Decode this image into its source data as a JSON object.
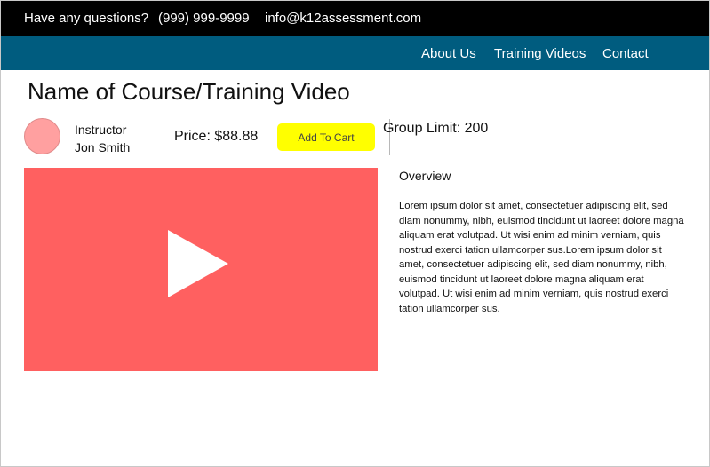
{
  "topbar": {
    "question": "Have any questions?",
    "phone": "(999) 999-9999",
    "email": "info@k12assessment.com"
  },
  "nav": {
    "items": [
      "About Us",
      "Training Videos",
      "Contact"
    ]
  },
  "course": {
    "title": "Name of Course/Training Video",
    "instructor_label": "Instructor",
    "instructor_name": "Jon Smith",
    "price": "Price: $88.88",
    "add_to_cart": "Add To Cart",
    "group_limit": "Group Limit: 200"
  },
  "overview": {
    "title": "Overview",
    "text": "Lorem ipsum dolor sit amet, consectetuer adipiscing elit, sed diam nonummy, nibh, euismod tincidunt ut laoreet dolore magna aliquam erat volutpad. Ut wisi enim ad minim verniam, quis nostrud exerci tation ullamcorper sus.Lorem ipsum dolor sit amet, consectetuer adipiscing elit, sed diam nonummy, nibh, euismod tincidunt ut laoreet dolore magna aliquam erat volutpad. Ut wisi enim ad minim verniam, quis nostrud exerci tation ullamcorper sus."
  },
  "colors": {
    "topbar_bg": "#000000",
    "nav_bg": "#005c7f",
    "video_bg": "#ff6060",
    "avatar": "#ffa0a0",
    "cart_button": "#ffff00"
  },
  "icons": {
    "play": "play-icon"
  }
}
